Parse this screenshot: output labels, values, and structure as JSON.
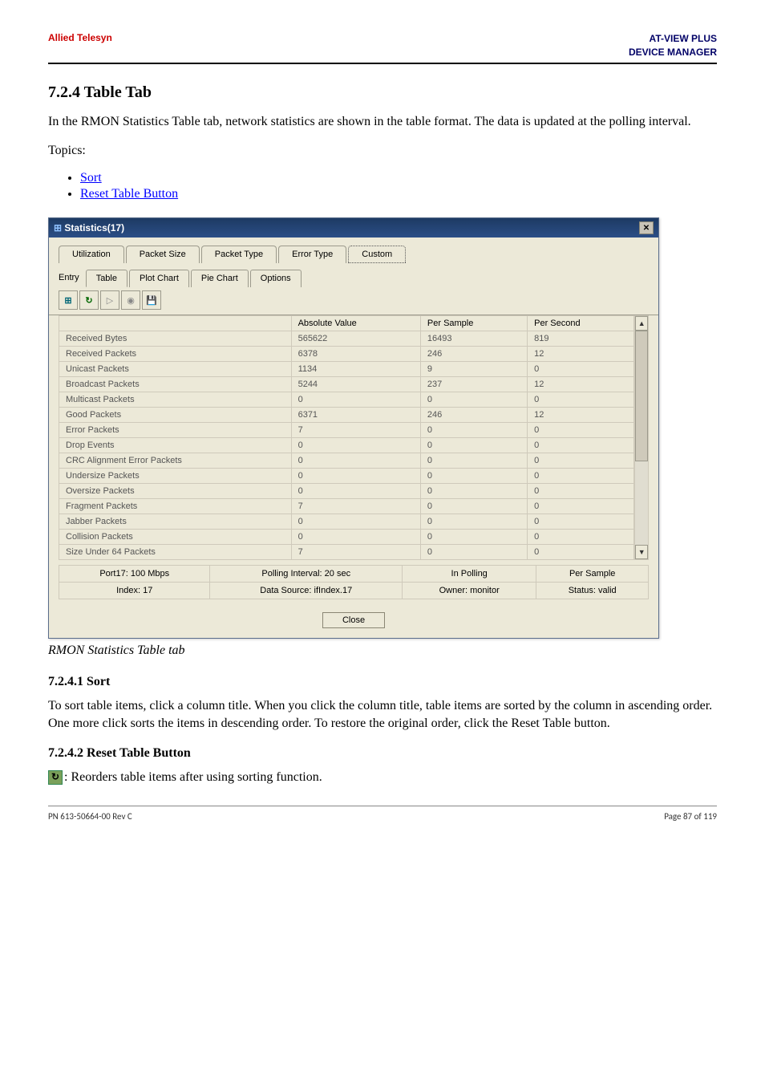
{
  "header": {
    "left": "Allied Telesyn",
    "right_line1": "AT-VIEW PLUS",
    "right_line2": "DEVICE MANAGER"
  },
  "section_title": "7.2.4 Table Tab",
  "intro_para": "In the RMON Statistics Table tab, network statistics are shown in the table format. The data is updated at the polling interval.",
  "topics_label": "Topics:",
  "bullet_links": {
    "sort": "Sort",
    "reset": "Reset Table Button"
  },
  "dialog": {
    "title": "Statistics(17)",
    "outer_tabs": {
      "utilization": "Utilization",
      "packet_size": "Packet Size",
      "packet_type": "Packet Type",
      "error_type": "Error Type",
      "custom": "Custom"
    },
    "inner_tabs": {
      "label": "Entry",
      "table": "Table",
      "plot_chart": "Plot Chart",
      "pie_chart": "Pie Chart",
      "options": "Options"
    },
    "columns": {
      "blank": "",
      "absolute": "Absolute Value",
      "per_sample": "Per Sample",
      "per_second": "Per Second"
    },
    "rows": [
      {
        "name": "Received Bytes",
        "abs": "565622",
        "samp": "16493",
        "sec": "819"
      },
      {
        "name": "Received Packets",
        "abs": "6378",
        "samp": "246",
        "sec": "12"
      },
      {
        "name": "Unicast Packets",
        "abs": "1134",
        "samp": "9",
        "sec": "0"
      },
      {
        "name": "Broadcast Packets",
        "abs": "5244",
        "samp": "237",
        "sec": "12"
      },
      {
        "name": "Multicast Packets",
        "abs": "0",
        "samp": "0",
        "sec": "0"
      },
      {
        "name": "Good Packets",
        "abs": "6371",
        "samp": "246",
        "sec": "12"
      },
      {
        "name": "Error Packets",
        "abs": "7",
        "samp": "0",
        "sec": "0"
      },
      {
        "name": "Drop Events",
        "abs": "0",
        "samp": "0",
        "sec": "0"
      },
      {
        "name": "CRC Alignment Error Packets",
        "abs": "0",
        "samp": "0",
        "sec": "0"
      },
      {
        "name": "Undersize Packets",
        "abs": "0",
        "samp": "0",
        "sec": "0"
      },
      {
        "name": "Oversize Packets",
        "abs": "0",
        "samp": "0",
        "sec": "0"
      },
      {
        "name": "Fragment Packets",
        "abs": "7",
        "samp": "0",
        "sec": "0"
      },
      {
        "name": "Jabber Packets",
        "abs": "0",
        "samp": "0",
        "sec": "0"
      },
      {
        "name": "Collision Packets",
        "abs": "0",
        "samp": "0",
        "sec": "0"
      },
      {
        "name": "Size Under 64 Packets",
        "abs": "7",
        "samp": "0",
        "sec": "0"
      }
    ],
    "status": {
      "port": "Port17: 100 Mbps",
      "poll": "Polling Interval: 20 sec",
      "inpoll": "In Polling",
      "persample": "Per Sample",
      "index": "Index: 17",
      "ds": "Data Source: ifIndex.17",
      "owner": "Owner: monitor",
      "statusv": "Status: valid"
    },
    "close": "Close"
  },
  "caption": "RMON Statistics Table tab",
  "sort_section": {
    "heading": "7.2.4.1 Sort",
    "body": "To sort table items, click a column title. When you click the column title, table items are sorted by the column in ascending order. One more click sorts the items in descending order. To restore the original order, click the Reset Table button."
  },
  "reset_section": {
    "heading": "7.2.4.2 Reset Table Button",
    "body": ": Reorders table items after using sorting function."
  },
  "footer": {
    "left": "PN 613-50664-00 Rev C",
    "right": "Page 87 of 119"
  }
}
